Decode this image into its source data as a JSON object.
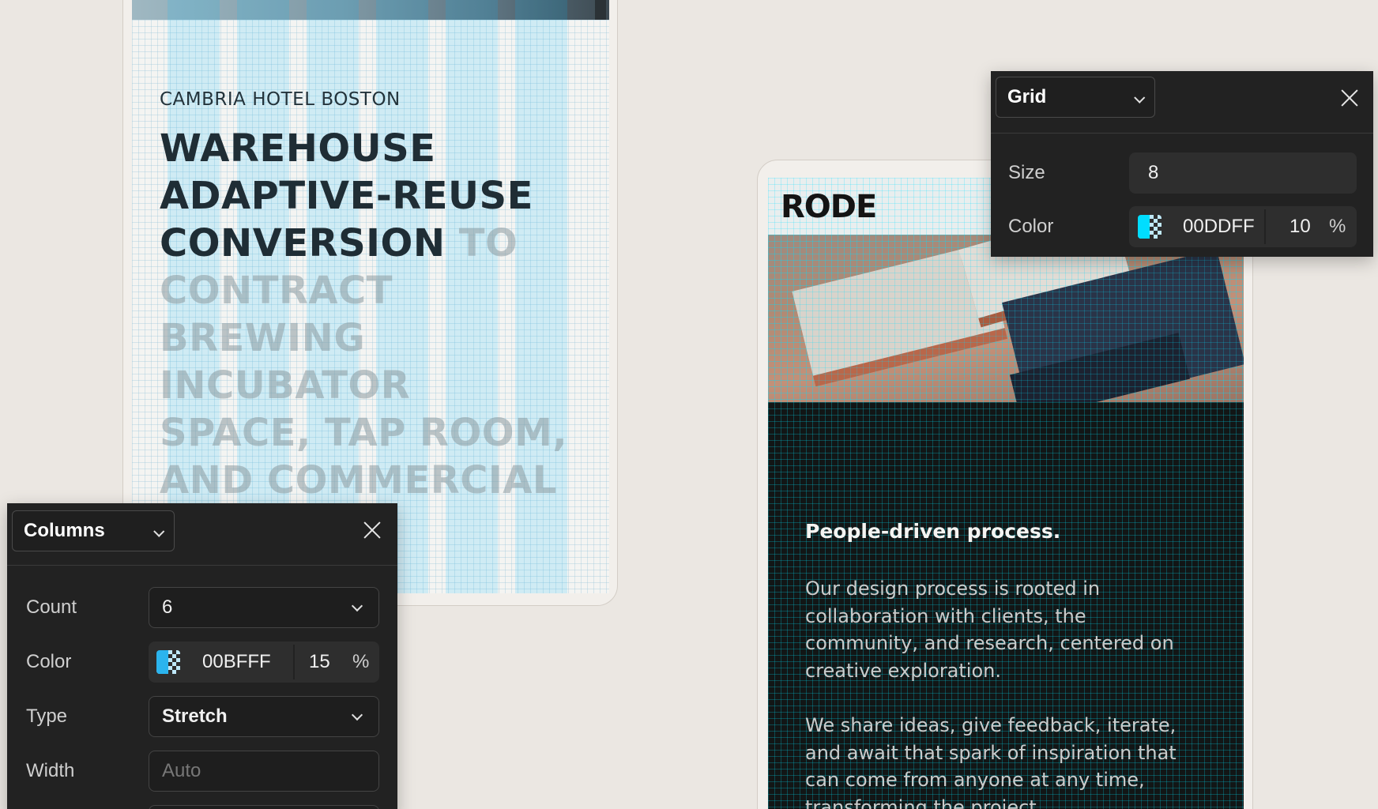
{
  "left_mockup": {
    "hotel_label": "CAMBRIA HOTEL BOSTON",
    "headline_strong": "WAREHOUSE ADAPTIVE-REUSE CONVERSION",
    "headline_muted": " TO CONTRACT BREWING INCUBATOR SPACE, TAP ROOM, AND COMMERCIAL"
  },
  "right_mockup": {
    "logo": "RODE",
    "heading": "People-driven process.",
    "paragraph_1": "Our design process is rooted in collaboration with clients, the community, and research, centered on creative exploration.",
    "paragraph_2": "We share ideas, give feedback, iterate, and await that spark of inspiration that can come from anyone at any time, transforming the project."
  },
  "columns_panel": {
    "mode": "Columns",
    "count_label": "Count",
    "count_value": "6",
    "color_label": "Color",
    "color_hex": "00BFFF",
    "color_opacity": "15",
    "percent_sign": "%",
    "type_label": "Type",
    "type_value": "Stretch",
    "width_label": "Width",
    "width_placeholder": "Auto",
    "swatch_color": "#00BFFF"
  },
  "grid_panel": {
    "mode": "Grid",
    "size_label": "Size",
    "size_value": "8",
    "color_label": "Color",
    "color_hex": "00DDFF",
    "color_opacity": "10",
    "percent_sign": "%",
    "swatch_color": "#00DDFF"
  }
}
